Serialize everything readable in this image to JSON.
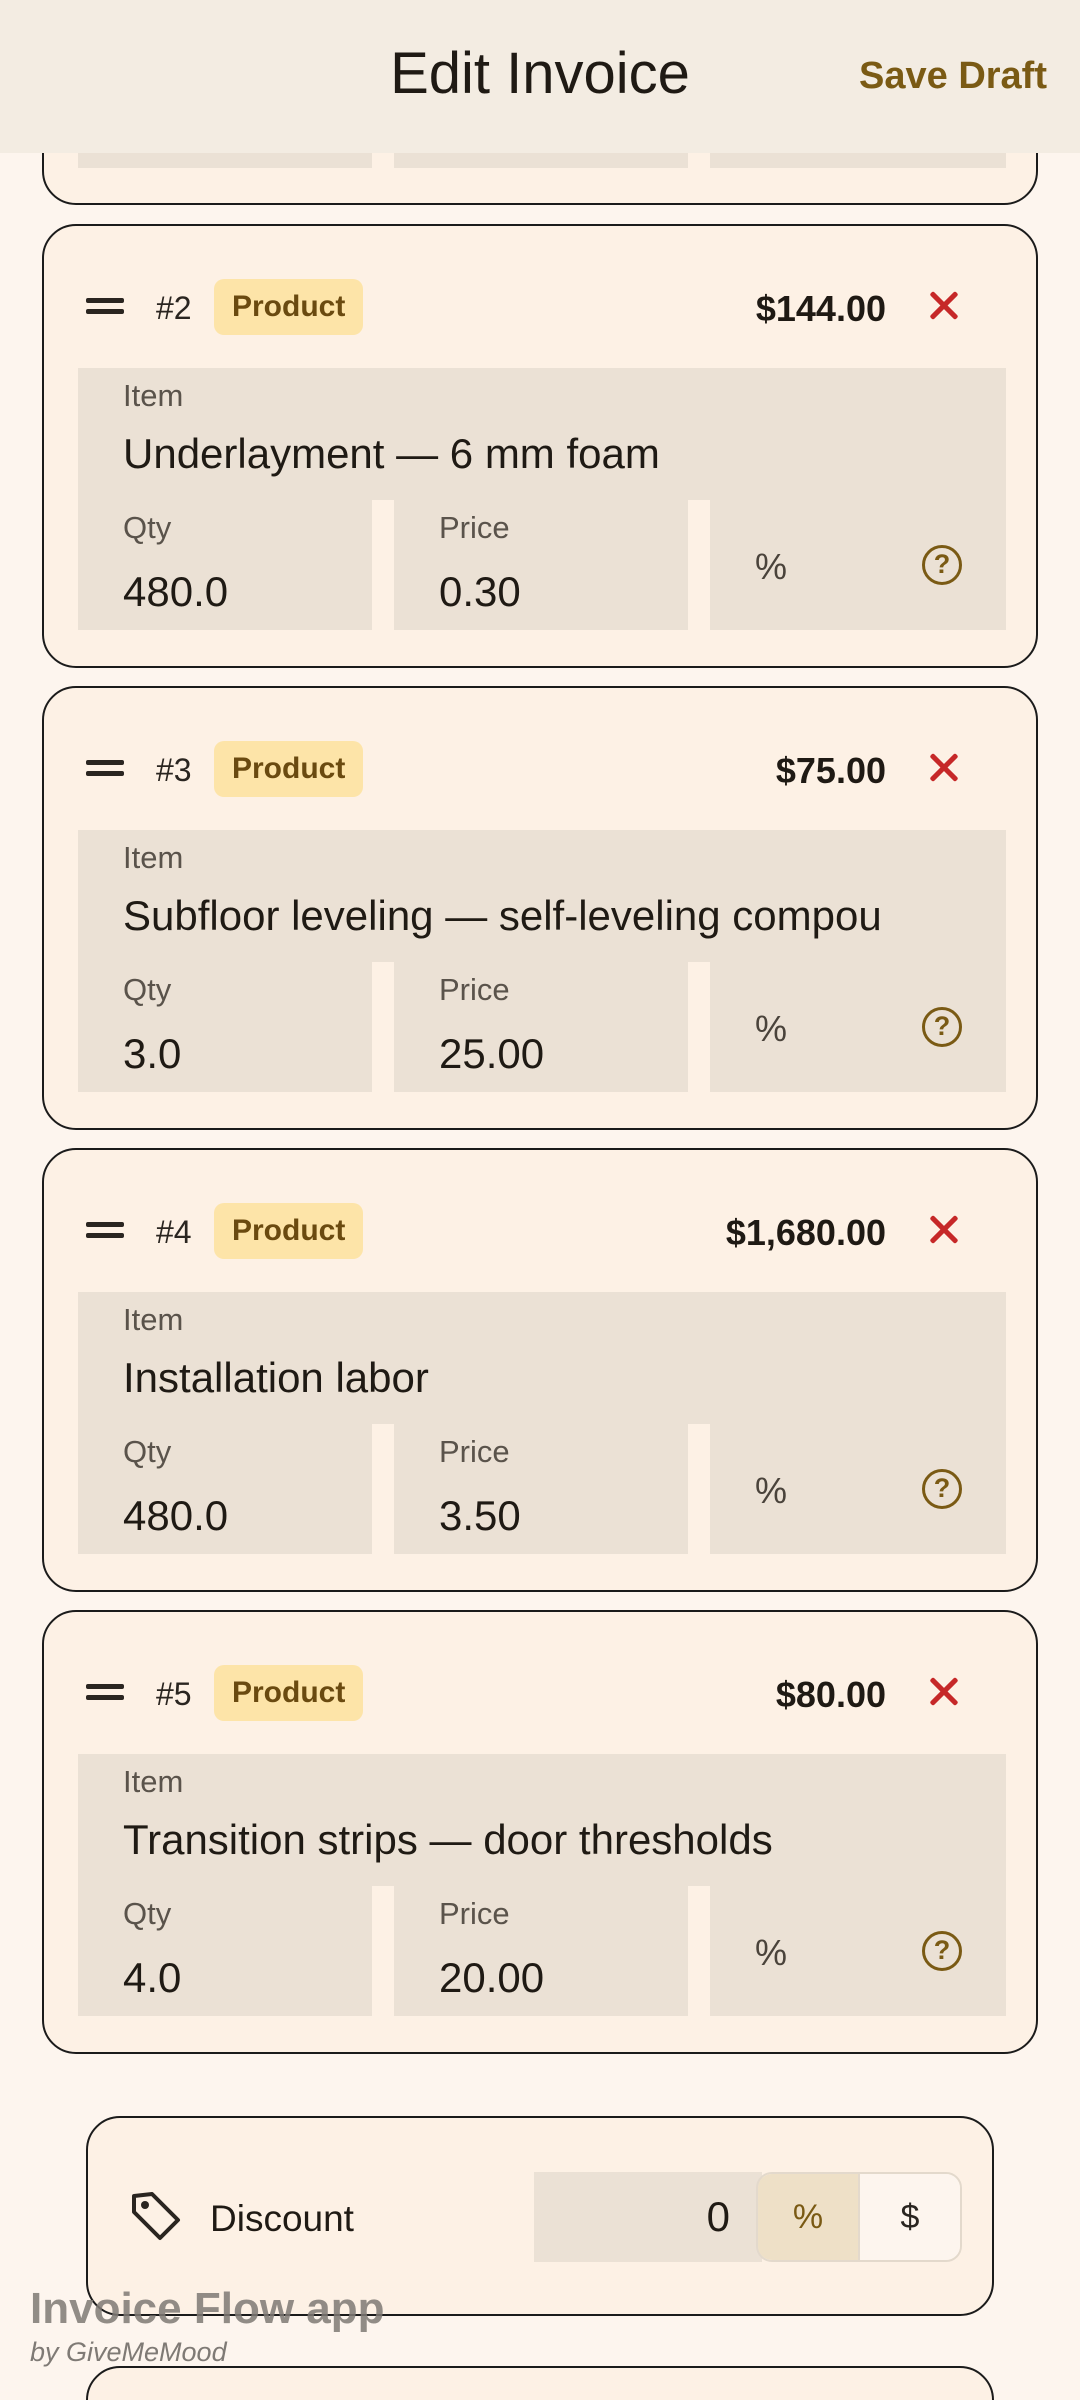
{
  "header": {
    "title": "Edit Invoice",
    "save_label": "Save Draft"
  },
  "line_items": [
    {
      "number": "#2",
      "type": "Product",
      "amount": "$144.00",
      "item_label": "Item",
      "item": "Underlayment — 6 mm foam",
      "qty_label": "Qty",
      "qty": "480.0",
      "price_label": "Price",
      "price": "0.30",
      "percent_symbol": "%"
    },
    {
      "number": "#3",
      "type": "Product",
      "amount": "$75.00",
      "item_label": "Item",
      "item": "Subfloor leveling — self-leveling compou",
      "qty_label": "Qty",
      "qty": "3.0",
      "price_label": "Price",
      "price": "25.00",
      "percent_symbol": "%"
    },
    {
      "number": "#4",
      "type": "Product",
      "amount": "$1,680.00",
      "item_label": "Item",
      "item": "Installation labor",
      "qty_label": "Qty",
      "qty": "480.0",
      "price_label": "Price",
      "price": "3.50",
      "percent_symbol": "%"
    },
    {
      "number": "#5",
      "type": "Product",
      "amount": "$80.00",
      "item_label": "Item",
      "item": "Transition strips — door thresholds",
      "qty_label": "Qty",
      "qty": "4.0",
      "price_label": "Price",
      "price": "20.00",
      "percent_symbol": "%"
    }
  ],
  "discount": {
    "label": "Discount",
    "value": "0",
    "percent_option": "%",
    "dollar_option": "$"
  },
  "watermark": {
    "title": "Invoice Flow app",
    "subtitle": "by GiveMeMood"
  },
  "colors": {
    "accent": "#7a5a14",
    "remove": "#c62828",
    "badge_bg": "#fde4a8",
    "card_bg": "#fdf1e5",
    "field_bg": "#ebe1d5"
  }
}
